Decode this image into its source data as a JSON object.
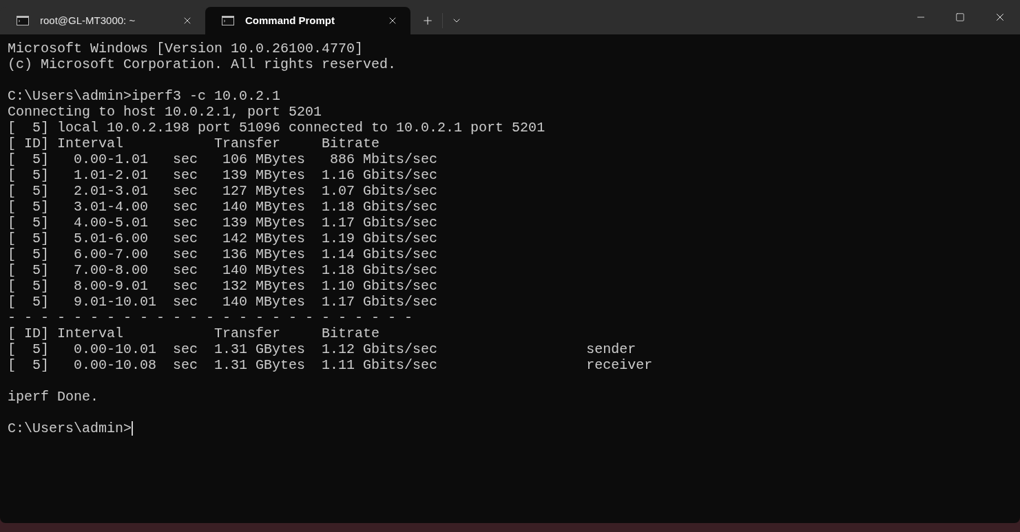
{
  "tabs": [
    {
      "title": "root@GL-MT3000: ~",
      "selected": false
    },
    {
      "title": "Command Prompt",
      "selected": true
    }
  ],
  "blocks": [
    {
      "lines": [
        "Microsoft Windows [Version 10.0.26100.4770]",
        "(c) Microsoft Corporation. All rights reserved."
      ]
    },
    {
      "lines": [
        "C:\\Users\\admin>iperf3 -c 10.0.2.1",
        "Connecting to host 10.0.2.1, port 5201",
        "[  5] local 10.0.2.198 port 51096 connected to 10.0.2.1 port 5201",
        "[ ID] Interval           Transfer     Bitrate",
        "[  5]   0.00-1.01   sec   106 MBytes   886 Mbits/sec",
        "[  5]   1.01-2.01   sec   139 MBytes  1.16 Gbits/sec",
        "[  5]   2.01-3.01   sec   127 MBytes  1.07 Gbits/sec",
        "[  5]   3.01-4.00   sec   140 MBytes  1.18 Gbits/sec",
        "[  5]   4.00-5.01   sec   139 MBytes  1.17 Gbits/sec",
        "[  5]   5.01-6.00   sec   142 MBytes  1.19 Gbits/sec",
        "[  5]   6.00-7.00   sec   136 MBytes  1.14 Gbits/sec",
        "[  5]   7.00-8.00   sec   140 MBytes  1.18 Gbits/sec",
        "[  5]   8.00-9.01   sec   132 MBytes  1.10 Gbits/sec",
        "[  5]   9.01-10.01  sec   140 MBytes  1.17 Gbits/sec",
        "- - - - - - - - - - - - - - - - - - - - - - - - -",
        "[ ID] Interval           Transfer     Bitrate",
        "[  5]   0.00-10.01  sec  1.31 GBytes  1.12 Gbits/sec                  sender",
        "[  5]   0.00-10.08  sec  1.31 GBytes  1.11 Gbits/sec                  receiver"
      ]
    },
    {
      "lines": [
        "iperf Done."
      ]
    }
  ],
  "prompt": {
    "text": "C:\\Users\\admin>",
    "cursor": true
  }
}
